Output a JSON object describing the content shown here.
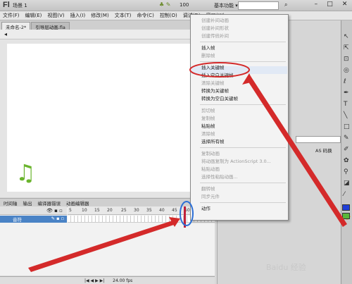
{
  "titlebar": {
    "logo": "Fl",
    "workspace": "基本功能 ▾",
    "search_placeholder": ""
  },
  "menubar": [
    "文件(F)",
    "编辑(E)",
    "视图(V)",
    "插入(I)",
    "修改(M)",
    "文本(T)",
    "命令(C)",
    "控制(O)",
    "调试(D)",
    "窗口(W)"
  ],
  "doc_tabs": [
    "未命名-2*",
    "引导层动画.fla"
  ],
  "scene": {
    "label": "场景 1",
    "zoom": "100"
  },
  "stage": {
    "note_glyph": "♫"
  },
  "timeline": {
    "tabs": [
      "时间轴",
      "输出",
      "编译器错误",
      "动画编辑器"
    ],
    "layer_name": "音符",
    "ruler_ticks": [
      "5",
      "10",
      "15",
      "20",
      "25",
      "30",
      "35",
      "40",
      "45",
      "50",
      "55",
      "6"
    ],
    "status": "24.00 fps"
  },
  "right_panel": {
    "as_label": "AS 码换"
  },
  "context_menu": {
    "items": [
      {
        "label": "创建补间动画",
        "disabled": true
      },
      {
        "label": "创建补间形状",
        "disabled": true
      },
      {
        "label": "创建传统补间",
        "disabled": true
      },
      {
        "label": "sep"
      },
      {
        "label": "插入帧",
        "disabled": false
      },
      {
        "label": "删除帧",
        "disabled": true
      },
      {
        "label": "sep"
      },
      {
        "label": "插入关键帧",
        "disabled": false,
        "highlight": true
      },
      {
        "label": "插入空白关键帧",
        "disabled": false
      },
      {
        "label": "清除关键帧",
        "disabled": true
      },
      {
        "label": "转换为关键帧",
        "disabled": false
      },
      {
        "label": "转换为空白关键帧",
        "disabled": false
      },
      {
        "label": "sep"
      },
      {
        "label": "剪切帧",
        "disabled": true
      },
      {
        "label": "复制帧",
        "disabled": true
      },
      {
        "label": "粘贴帧",
        "disabled": false
      },
      {
        "label": "清除帧",
        "disabled": true
      },
      {
        "label": "选择所有帧",
        "disabled": false
      },
      {
        "label": "sep"
      },
      {
        "label": "复制动画",
        "disabled": true
      },
      {
        "label": "将动画复制为 ActionScript 3.0...",
        "disabled": true
      },
      {
        "label": "粘贴动画",
        "disabled": true
      },
      {
        "label": "选择性粘贴动画...",
        "disabled": true
      },
      {
        "label": "sep"
      },
      {
        "label": "翻转帧",
        "disabled": true
      },
      {
        "label": "同步元件",
        "disabled": true
      },
      {
        "label": "sep"
      },
      {
        "label": "动作",
        "disabled": false
      }
    ]
  },
  "watermark": "Baidu 经验",
  "colors": {
    "annotation_red": "#d42a2a",
    "menu_highlight": "#e1e9f5",
    "layer_blue": "#4a83c6"
  }
}
